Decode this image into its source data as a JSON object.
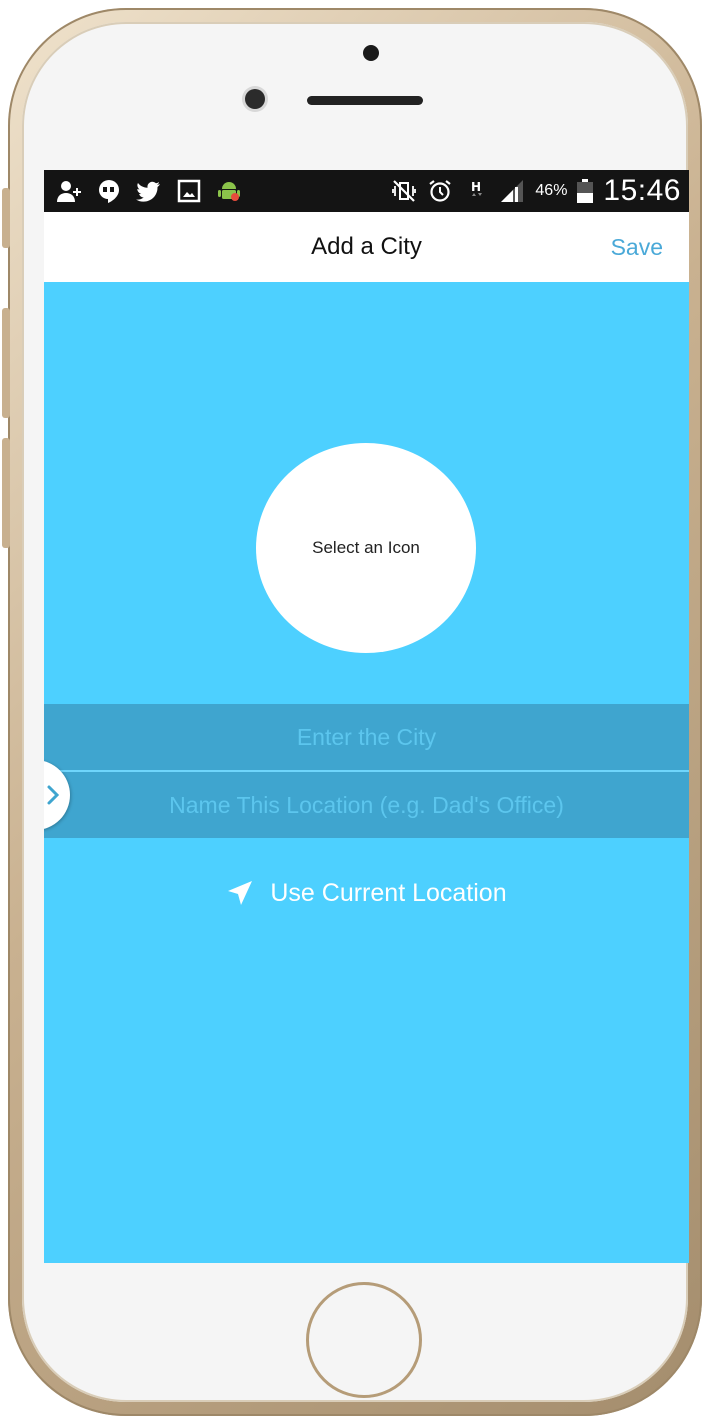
{
  "status_bar": {
    "left_icons": [
      "add-person-icon",
      "hangouts-icon",
      "twitter-icon",
      "gallery-icon",
      "android-icon"
    ],
    "right_icons": [
      "vibrate-icon",
      "alarm-icon",
      "hspa-icon",
      "signal-icon"
    ],
    "battery_percent": "46%",
    "battery_level": 0.46,
    "time": "15:46"
  },
  "nav": {
    "title": "Add a City",
    "save_label": "Save"
  },
  "icon_picker": {
    "label": "Select an Icon"
  },
  "form": {
    "city_placeholder": "Enter the City",
    "city_value": "",
    "location_name_placeholder": "Name This Location (e.g. Dad's Office)",
    "location_name_value": ""
  },
  "current_location": {
    "label": "Use Current Location"
  },
  "colors": {
    "screen_background": "#4dd0ff",
    "field_background": "#3fa5cf",
    "accent": "#4aa9d8"
  }
}
